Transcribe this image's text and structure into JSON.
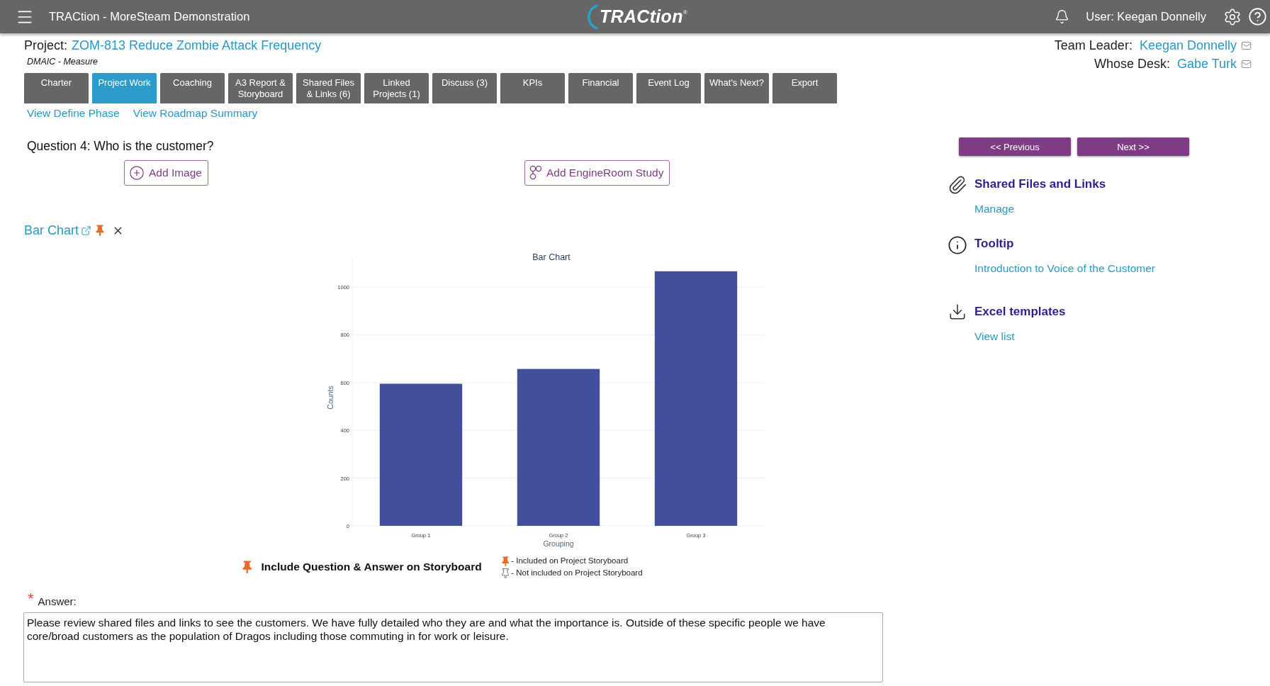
{
  "top_bar": {
    "app_title": "TRACtion - MoreSteam Demonstration",
    "logo": "TRACtion$^{®}$",
    "user": "User: Keegan Donnelly"
  },
  "project": {
    "label": "Project:",
    "name": "ZOM-813 Reduce Zombie Attack Frequency",
    "phase": "DMAIC - Measure"
  },
  "team": [
    {
      "label": "Team Leader:",
      "name": "Keegan Donnelly"
    },
    {
      "label": "Whose Desk:",
      "name": "Gabe Turk"
    }
  ],
  "tabs": [
    {
      "label": "Charter",
      "selected": false
    },
    {
      "label": "Project Work",
      "selected": true
    },
    {
      "label": "Coaching",
      "selected": false
    },
    {
      "label": "A3 Report & Storyboard",
      "selected": false
    },
    {
      "label": "Shared Files & Links (6)",
      "selected": false
    },
    {
      "label": "Linked Projects (1)",
      "selected": false
    },
    {
      "label": "Discuss (3)",
      "selected": false
    },
    {
      "label": "KPIs",
      "selected": false
    },
    {
      "label": "Financial",
      "selected": false
    },
    {
      "label": "Event Log",
      "selected": false
    },
    {
      "label": "What's Next?",
      "selected": false
    },
    {
      "label": "Export",
      "selected": false
    }
  ],
  "phase_links": [
    "View Define Phase",
    "View Roadmap Summary"
  ],
  "question": "Question 4: Who is the customer?",
  "add_buttons": [
    {
      "kind": "image",
      "label": "Add Image"
    },
    {
      "kind": "study",
      "label": "Add EngineRoom Study"
    }
  ],
  "attachment": {
    "title": "Bar Chart",
    "pinned": true,
    "chart_data": [
      {
        "type": "bar",
        "title": "Bar Chart",
        "xlabel": "Grouping",
        "ylabel": "Counts",
        "categories": [
          "Group 1",
          "Group 2",
          "Group 3"
        ],
        "values": [
          595,
          657,
          1066
        ],
        "color": "#42509c",
        "ylim": [
          0,
          1120
        ],
        "yticks": [
          0,
          200,
          400,
          600,
          800,
          1000
        ],
        "grid": true
      }
    ]
  },
  "storyboard": {
    "label": "Include Question & Answer on Storyboard",
    "included": true,
    "legend": [
      {
        "kind": "included",
        "label": "- Included on Project Storyboard"
      },
      {
        "kind": "not_included",
        "label": "- Not included on Project Storyboard"
      }
    ]
  },
  "answer": {
    "required_mark": "*",
    "label": "Answer:",
    "value": "Please review shared files and links to see the customers. We have fully detailed who they are and what the importance is. Outside of these specific people we have core/broad customers as the population of Dragos including those commuting in for work or leisure."
  },
  "nav_buttons": [
    "<< Previous",
    "Next >>"
  ],
  "resources": [
    {
      "kind": "attachment",
      "title": "Shared Files and Links",
      "link": "Manage"
    },
    {
      "kind": "info",
      "title": "Tooltip",
      "link": "Introduction to Voice of the Customer"
    },
    {
      "kind": "download",
      "title": "Excel templates",
      "link": "View list"
    }
  ]
}
